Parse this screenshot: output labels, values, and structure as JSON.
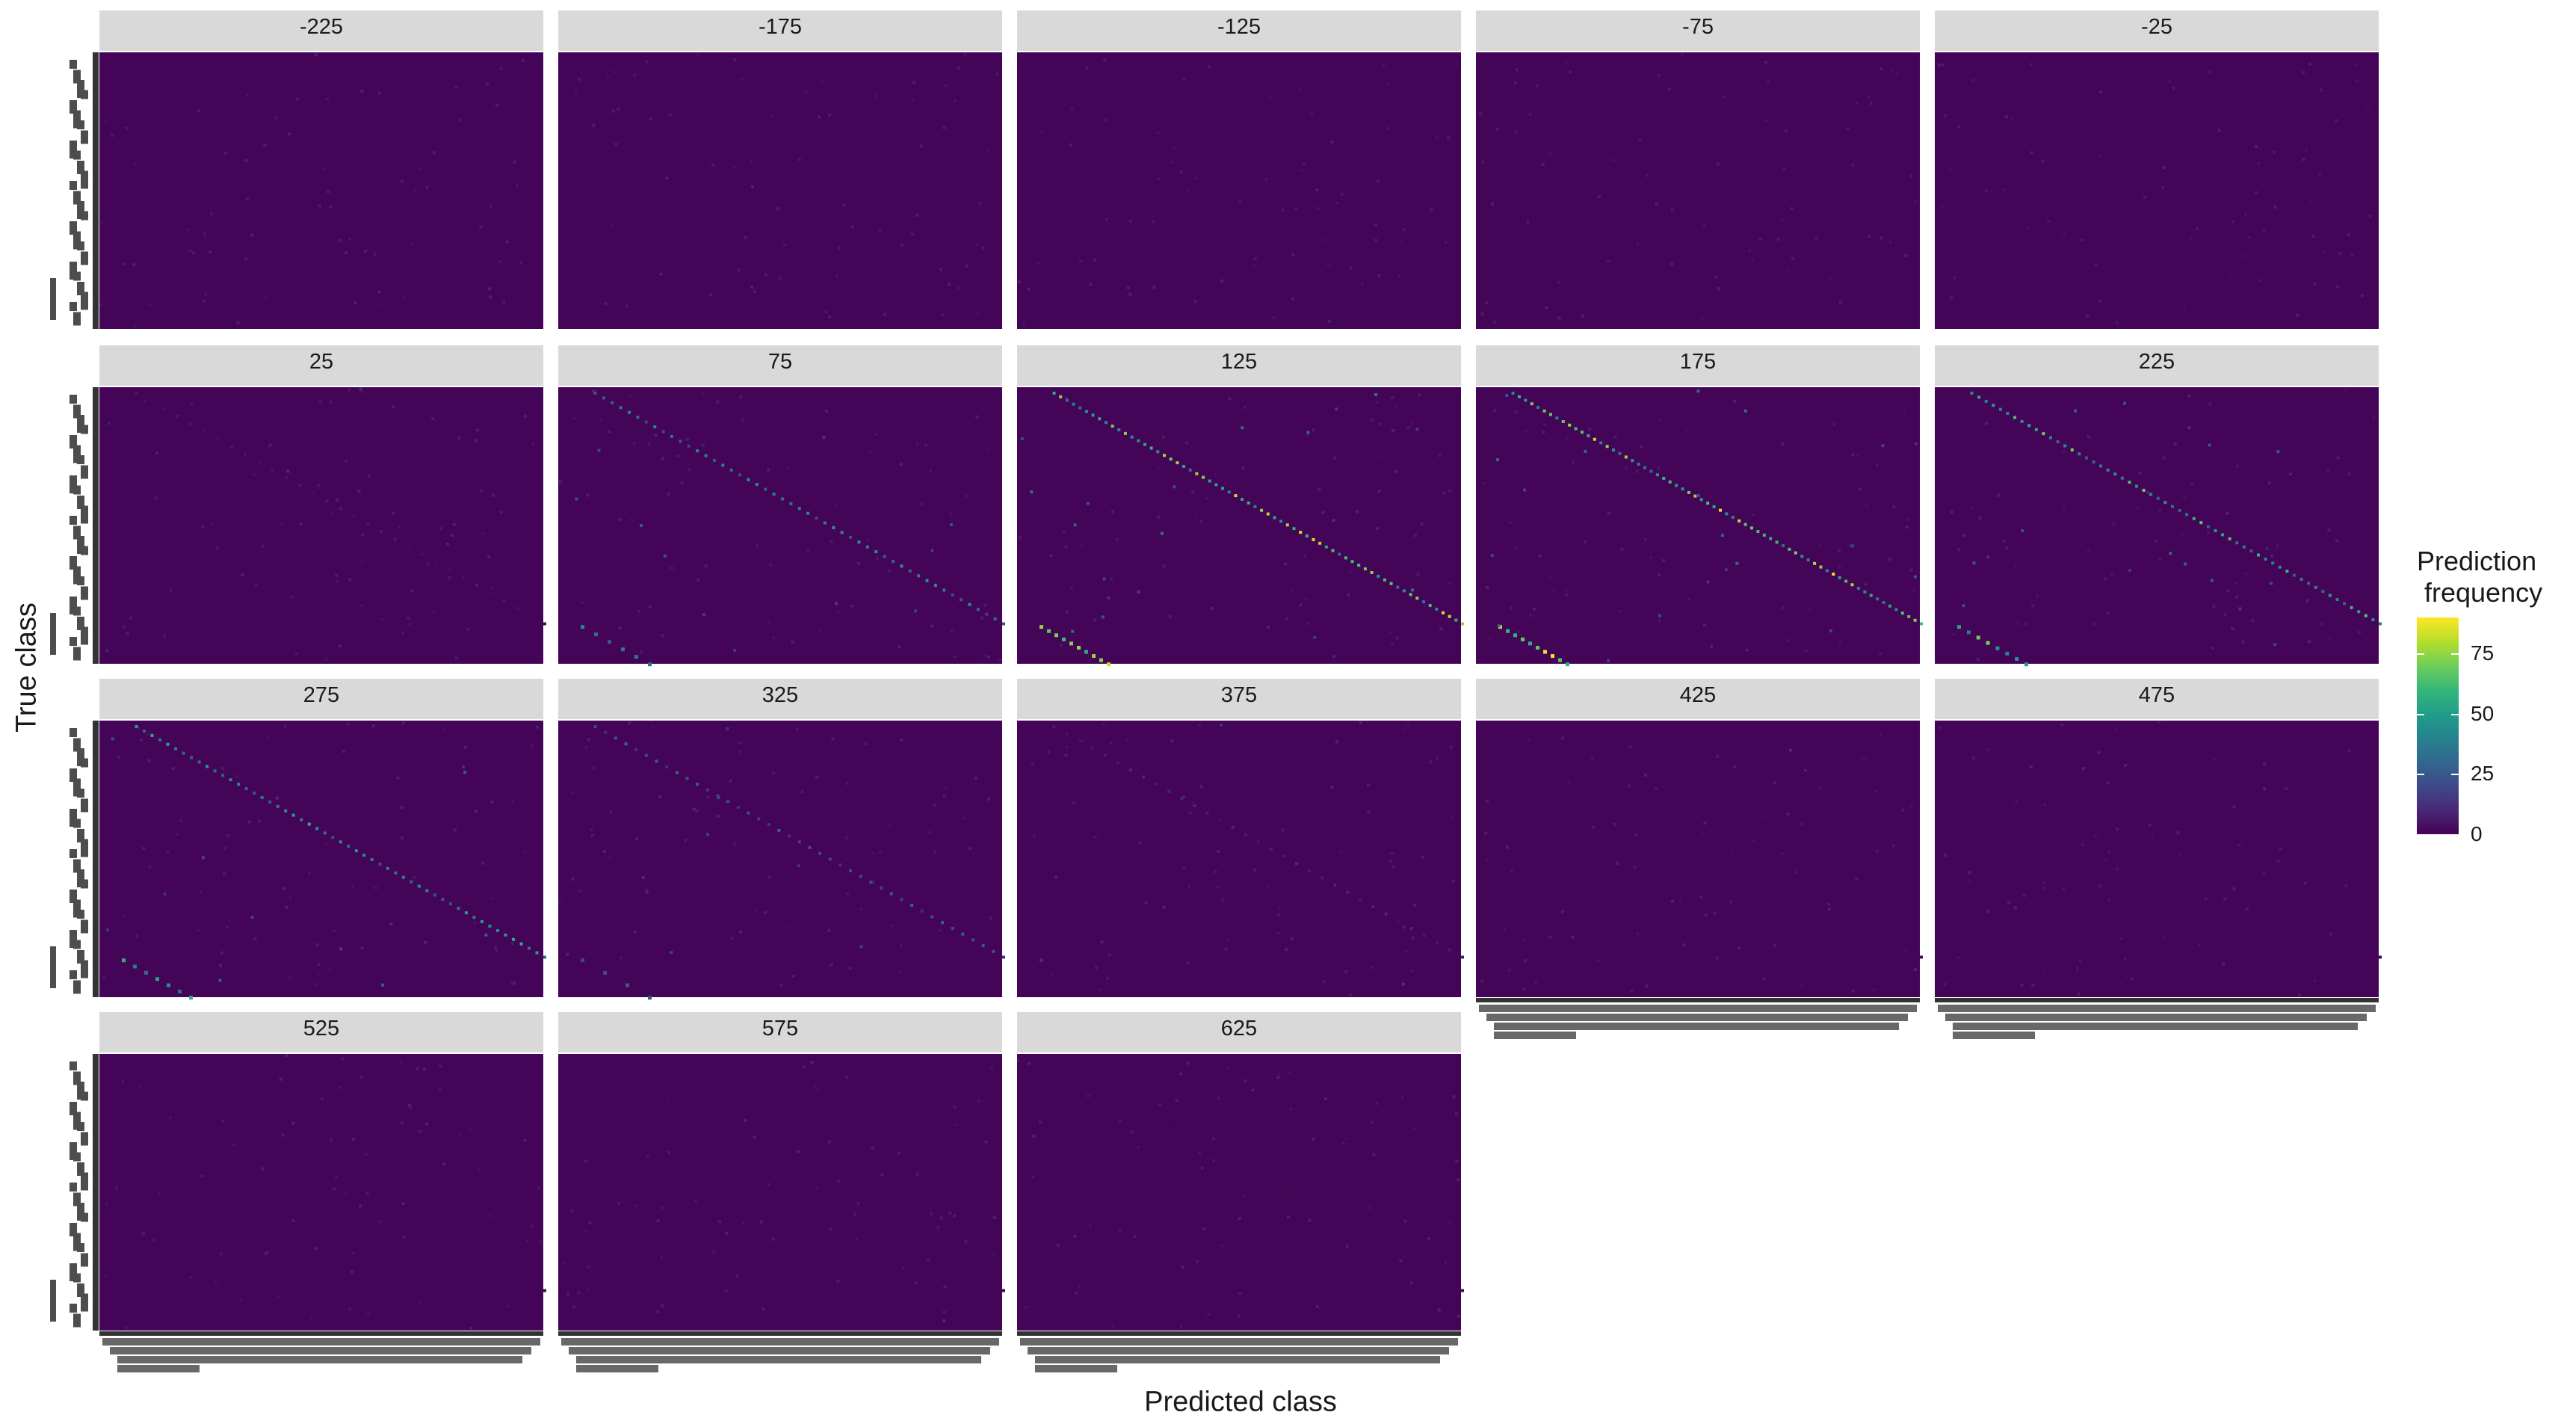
{
  "chart_data": {
    "type": "heatmap",
    "facet_by": "offset",
    "panels": [
      {
        "label": "-225",
        "diag_strength": 0.0
      },
      {
        "label": "-175",
        "diag_strength": 0.0
      },
      {
        "label": "-125",
        "diag_strength": 0.0
      },
      {
        "label": "-75",
        "diag_strength": 0.0
      },
      {
        "label": "-25",
        "diag_strength": 0.0
      },
      {
        "label": "25",
        "diag_strength": 0.08
      },
      {
        "label": "75",
        "diag_strength": 0.55
      },
      {
        "label": "125",
        "diag_strength": 0.95
      },
      {
        "label": "175",
        "diag_strength": 1.0
      },
      {
        "label": "225",
        "diag_strength": 0.8
      },
      {
        "label": "275",
        "diag_strength": 0.65
      },
      {
        "label": "325",
        "diag_strength": 0.35
      },
      {
        "label": "375",
        "diag_strength": 0.12
      },
      {
        "label": "425",
        "diag_strength": 0.03
      },
      {
        "label": "475",
        "diag_strength": 0.02
      },
      {
        "label": "525",
        "diag_strength": 0.02
      },
      {
        "label": "575",
        "diag_strength": 0.02
      },
      {
        "label": "625",
        "diag_strength": 0.02
      }
    ],
    "xlabel": "Predicted class",
    "ylabel": "True class",
    "legend": {
      "title": "Prediction\n frequency",
      "ticks": [
        0,
        25,
        50,
        75
      ],
      "range": [
        0,
        90
      ],
      "placement": "right"
    },
    "palette": [
      "#440154",
      "#482878",
      "#3e4989",
      "#31688e",
      "#26828e",
      "#1f9e89",
      "#35b779",
      "#6ece58",
      "#b5de2b",
      "#fde725"
    ],
    "strip_color": "#d9d9d9",
    "tick_label_color": "#4d4d4d"
  }
}
